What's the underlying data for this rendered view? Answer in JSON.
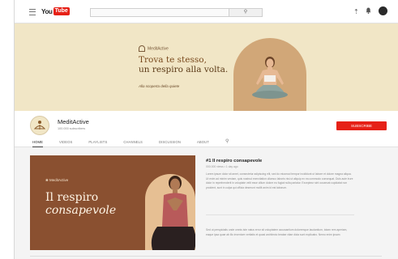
{
  "topbar": {
    "logo_you": "You",
    "logo_tube": "Tube",
    "search_icon": "search-icon",
    "search_placeholder": "",
    "icons": [
      "upload-icon",
      "bell-icon"
    ]
  },
  "banner": {
    "brand": "MeditActive",
    "headline_line1": "Trova te stesso,",
    "headline_line2": "un respiro alla volta.",
    "tagline": "Alla scoperta della quiete",
    "colors": {
      "background": "#f1e6c6",
      "accent": "#d1a778",
      "text": "#5c3a17"
    }
  },
  "channel": {
    "name": "MeditActive",
    "subscribers": "100.000 subscribers",
    "subscribe_label": "SUBSCRIBE",
    "subscribe_color": "#e62117"
  },
  "tabs": [
    {
      "label": "HOME",
      "active": true
    },
    {
      "label": "VIDEOS",
      "active": false
    },
    {
      "label": "PLAYLISTS",
      "active": false
    },
    {
      "label": "CHANNELS",
      "active": false
    },
    {
      "label": "DISCUSSION",
      "active": false
    },
    {
      "label": "ABOUT",
      "active": false
    }
  ],
  "featured": {
    "thumb_brand": "MeditActive",
    "thumb_title_line1": "Il respiro",
    "thumb_title_line2": "consapevole",
    "title": "#1 Il respiro consapevole",
    "meta": "000.000 views • 1 day ago",
    "description": "Lorem ipsum dolor sit amet, consectetur adipiscing elit, sed do eiusmod tempor incididunt ut labore et dolore magna aliqua. Ut enim ad minim veniam, quis nostrud exercitation ullamco laboris nisi ut aliquip ex ea commodo consequat. Duis aute irure dolor in reprehenderit in voluptate velit esse cillum dolore eu fugiat nulla pariatur. Excepteur sint occaecat cupidatat non proident, sunt in culpa qui officia deserunt mollit anim id est laborum.",
    "description2": "Sed ut perspiciatis unde omnis iste natus error sit voluptatem accusantium doloremque laudantium, totam rem aperiam, eaque ipsa quae ab illo inventore veritatis et quasi architecto beatae vitae dicta sunt explicabo. Nemo enim ipsam"
  }
}
